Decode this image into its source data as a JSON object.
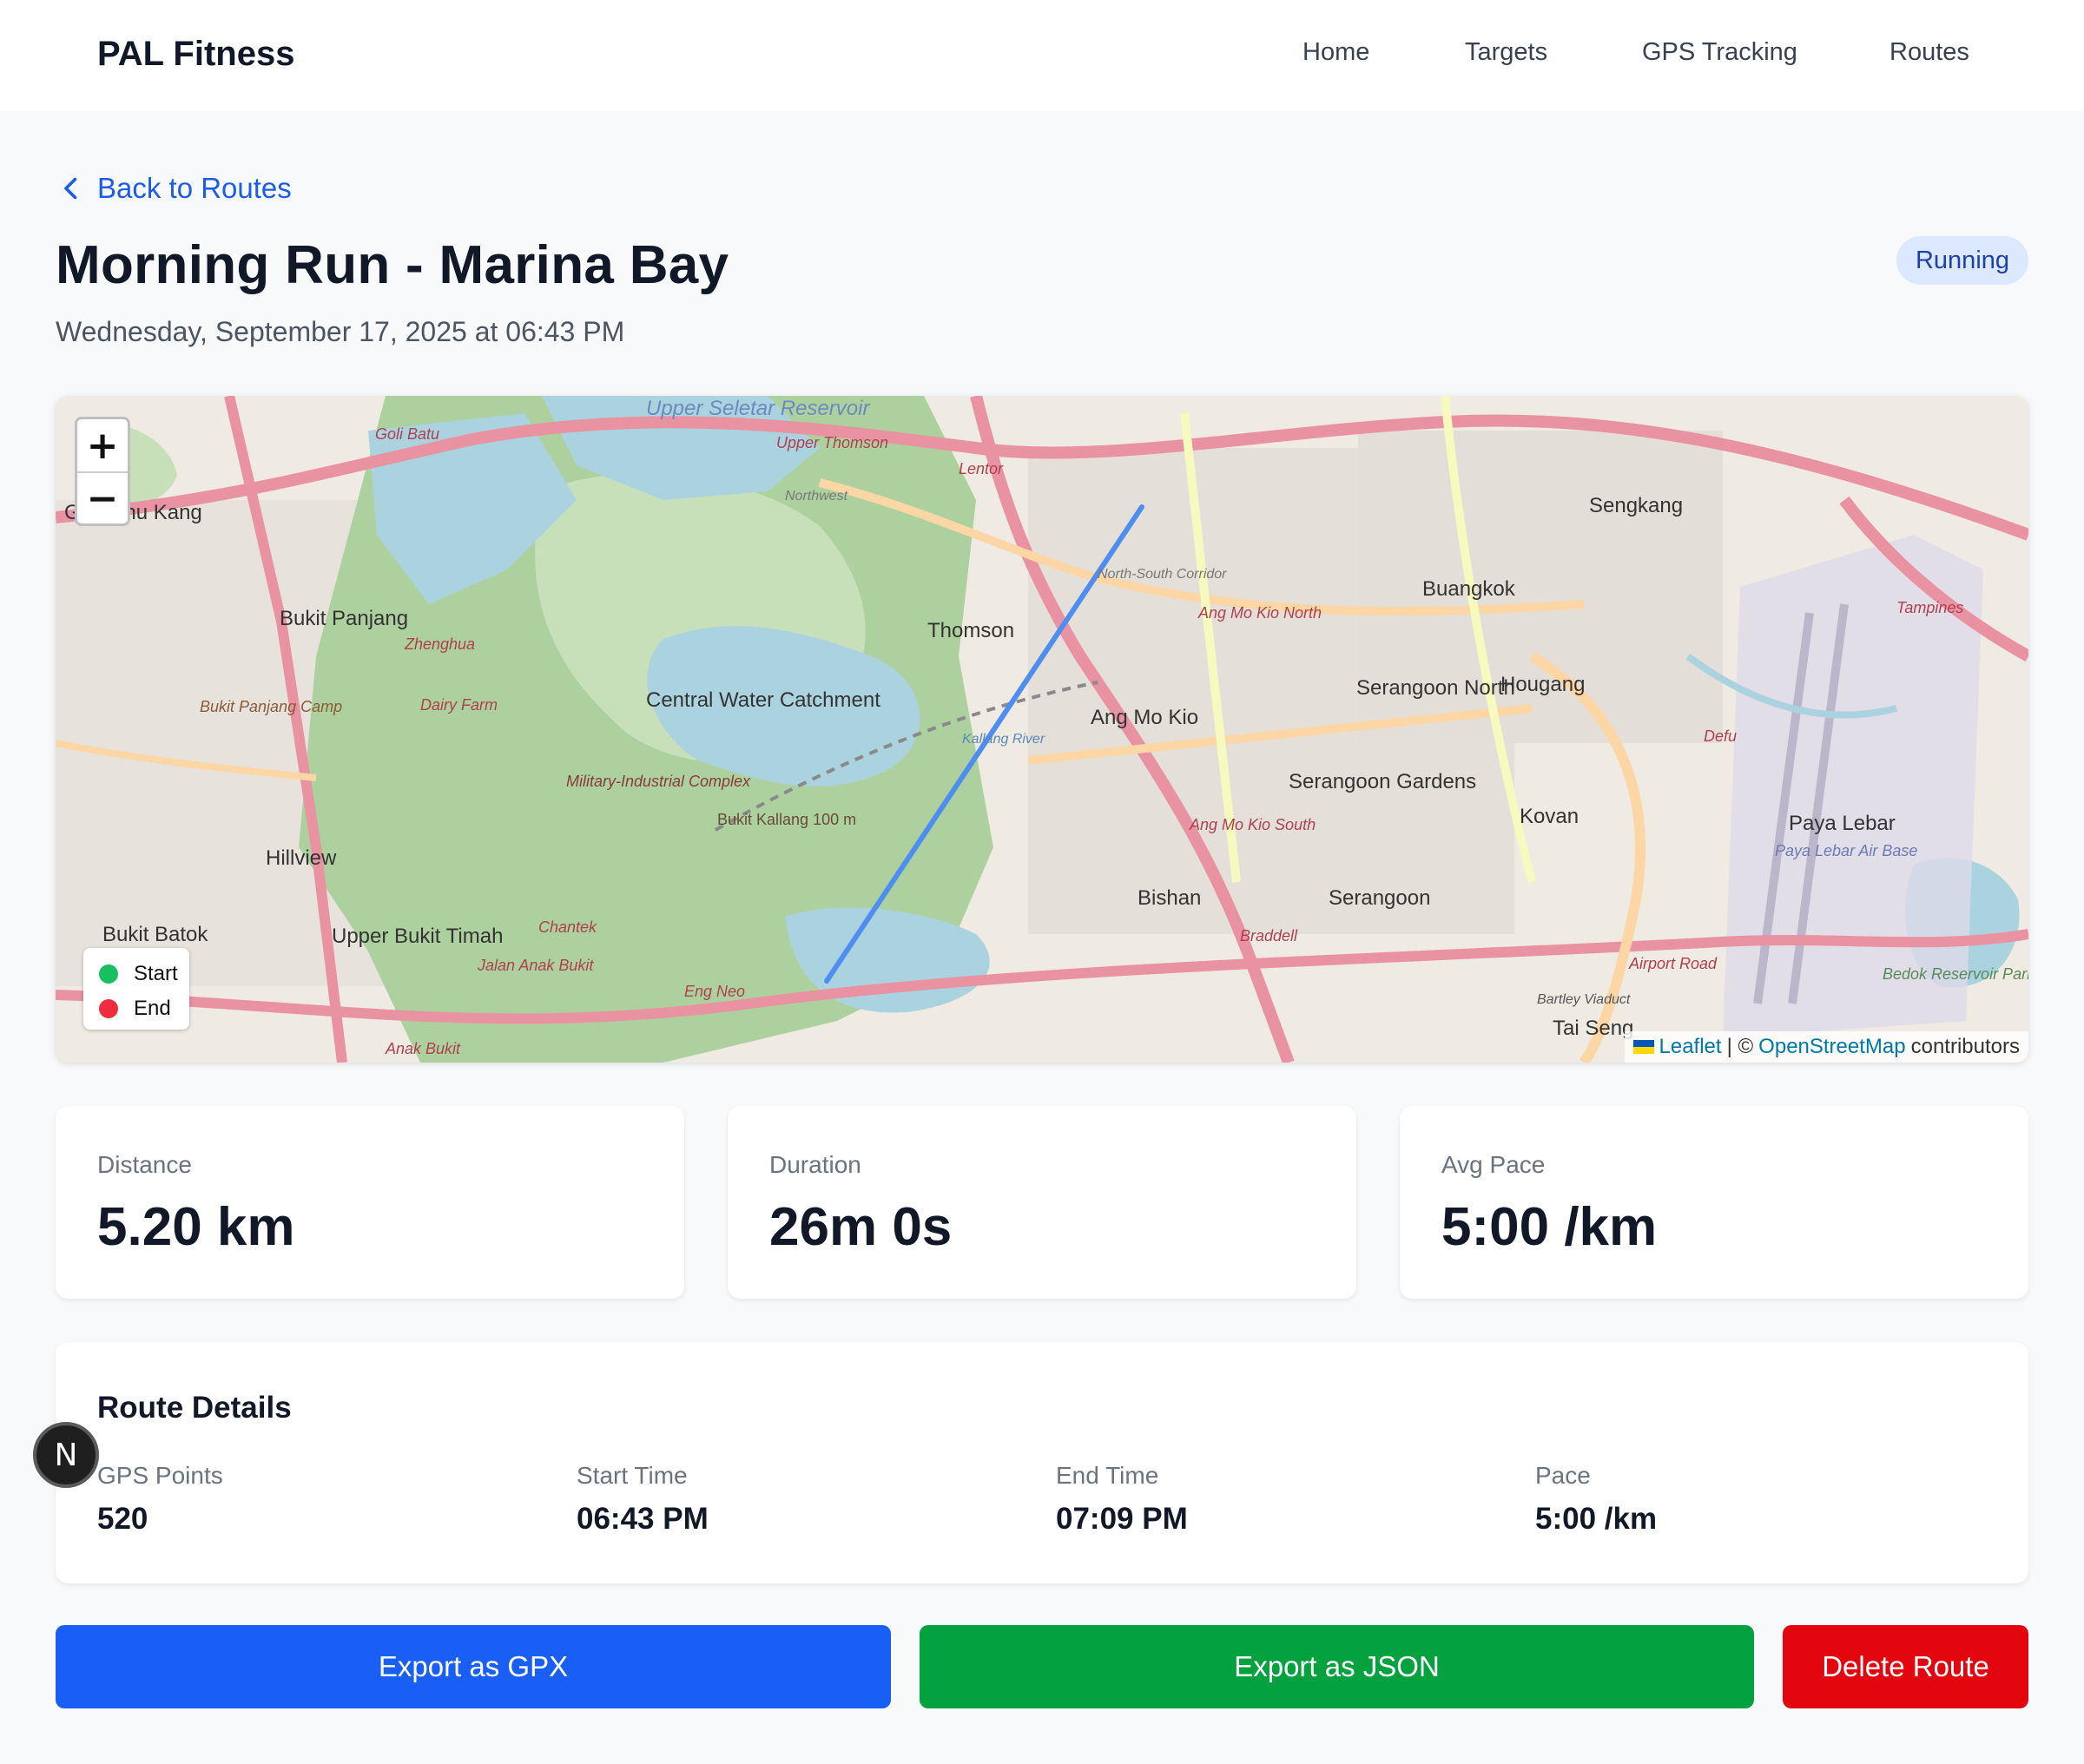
{
  "header": {
    "brand": "PAL Fitness",
    "nav": [
      "Home",
      "Targets",
      "GPS Tracking",
      "Routes"
    ]
  },
  "back_link": "Back to Routes",
  "route": {
    "title": "Morning Run - Marina Bay",
    "datetime": "Wednesday, September 17, 2025 at 06:43 PM",
    "activity": "Running"
  },
  "map": {
    "zoom_in": "+",
    "zoom_out": "−",
    "legend": {
      "start": "Start",
      "end": "End"
    },
    "colors": {
      "route": "#4f8ef0",
      "start": "#16c060",
      "end": "#ef2d3f"
    },
    "attribution": {
      "leaflet": "Leaflet",
      "separator": "| ©",
      "osm": "OpenStreetMap",
      "suffix": "contributors"
    },
    "place_labels": [
      "Upper Seletar Reservoir",
      "Goh Chu Kang",
      "Goli Batu",
      "Upper Thomson",
      "Lentor",
      "Sengkang",
      "Buangkok",
      "Bukit Panjang",
      "Zhenghua",
      "Thomson",
      "Ang Mo Kio North",
      "Tampines",
      "Central Water Catchment",
      "Serangoon North",
      "Hougang",
      "Ang Mo Kio",
      "Bukit Panjang Camp",
      "Dairy Farm",
      "Serangoon Gardens",
      "Military-Industrial Complex",
      "Bukit Kallang 100 m",
      "Kovan",
      "Paya Lebar",
      "Paya Lebar Air Base",
      "Hillview",
      "Ang Mo Kio South",
      "Bishan",
      "Serangoon",
      "Bukit Batok",
      "Upper Bukit Timah",
      "Chantek",
      "Braddell",
      "Jalan Anak Bukit",
      "Eng Neo",
      "Airport Road",
      "Bedok Reservoir Park",
      "Tai Seng",
      "Bartley Viaduct",
      "Anak Bukit",
      "Kallang River",
      "North-South Corridor",
      "Defu",
      "Northwest"
    ]
  },
  "stats": [
    {
      "label": "Distance",
      "value": "5.20 km"
    },
    {
      "label": "Duration",
      "value": "26m 0s"
    },
    {
      "label": "Avg Pace",
      "value": "5:00 /km"
    }
  ],
  "details": {
    "title": "Route Details",
    "items": [
      {
        "label": "GPS Points",
        "value": "520"
      },
      {
        "label": "Start Time",
        "value": "06:43 PM"
      },
      {
        "label": "End Time",
        "value": "07:09 PM"
      },
      {
        "label": "Pace",
        "value": "5:00 /km"
      }
    ]
  },
  "dev_badge": "N",
  "actions": {
    "export_gpx": "Export as GPX",
    "export_json": "Export as JSON",
    "delete": "Delete Route"
  },
  "button_colors": {
    "gpx": "#1a5ff5",
    "json": "#04a23e",
    "delete": "#e3060f"
  }
}
